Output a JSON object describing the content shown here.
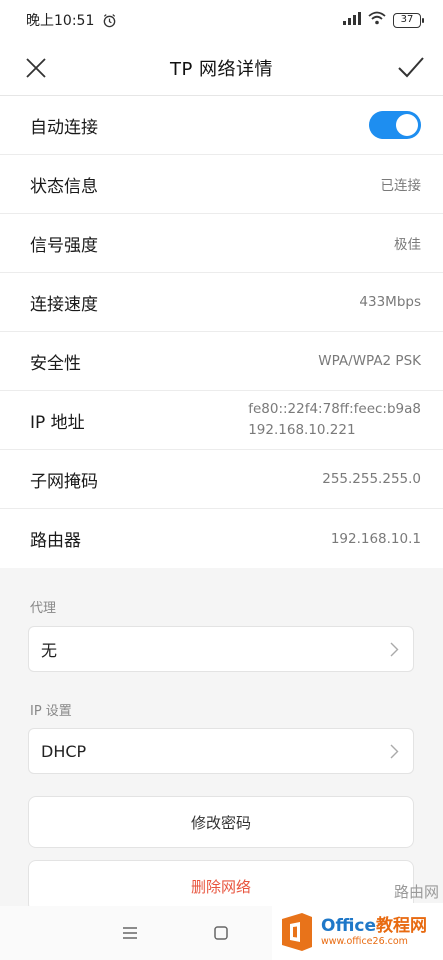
{
  "status_bar": {
    "time": "晚上10:51",
    "battery": "37",
    "icons": [
      "alarm-icon",
      "signal-icon",
      "wifi-icon",
      "battery-icon"
    ]
  },
  "header": {
    "title": "TP  网络详情",
    "close_icon": "close-icon",
    "confirm_icon": "check-icon"
  },
  "info_rows": [
    {
      "label": "自动连接",
      "type": "toggle",
      "on": true
    },
    {
      "label": "状态信息",
      "value": "已连接"
    },
    {
      "label": "信号强度",
      "value": "极佳"
    },
    {
      "label": "连接速度",
      "value": "433Mbps"
    },
    {
      "label": "安全性",
      "value": "WPA/WPA2 PSK"
    },
    {
      "label": "IP 地址",
      "value_line1": "fe80::22f4:78ff:feec:b9a8",
      "value_line2": "192.168.10.221"
    },
    {
      "label": "子网掩码",
      "value": "255.255.255.0"
    },
    {
      "label": "路由器",
      "value": "192.168.10.1"
    }
  ],
  "proxy": {
    "label": "代理",
    "value": "无"
  },
  "ip_settings": {
    "label": "IP 设置",
    "value": "DHCP"
  },
  "buttons": {
    "modify_password": "修改密码",
    "delete_network": "删除网络"
  },
  "watermark": {
    "brand_a": "Office",
    "brand_b": "教程网",
    "url": "www.office26.com",
    "small": "路由网"
  },
  "colors": {
    "accent": "#1e8ef0",
    "danger": "#e8553f",
    "background": "#f5f5f5"
  }
}
